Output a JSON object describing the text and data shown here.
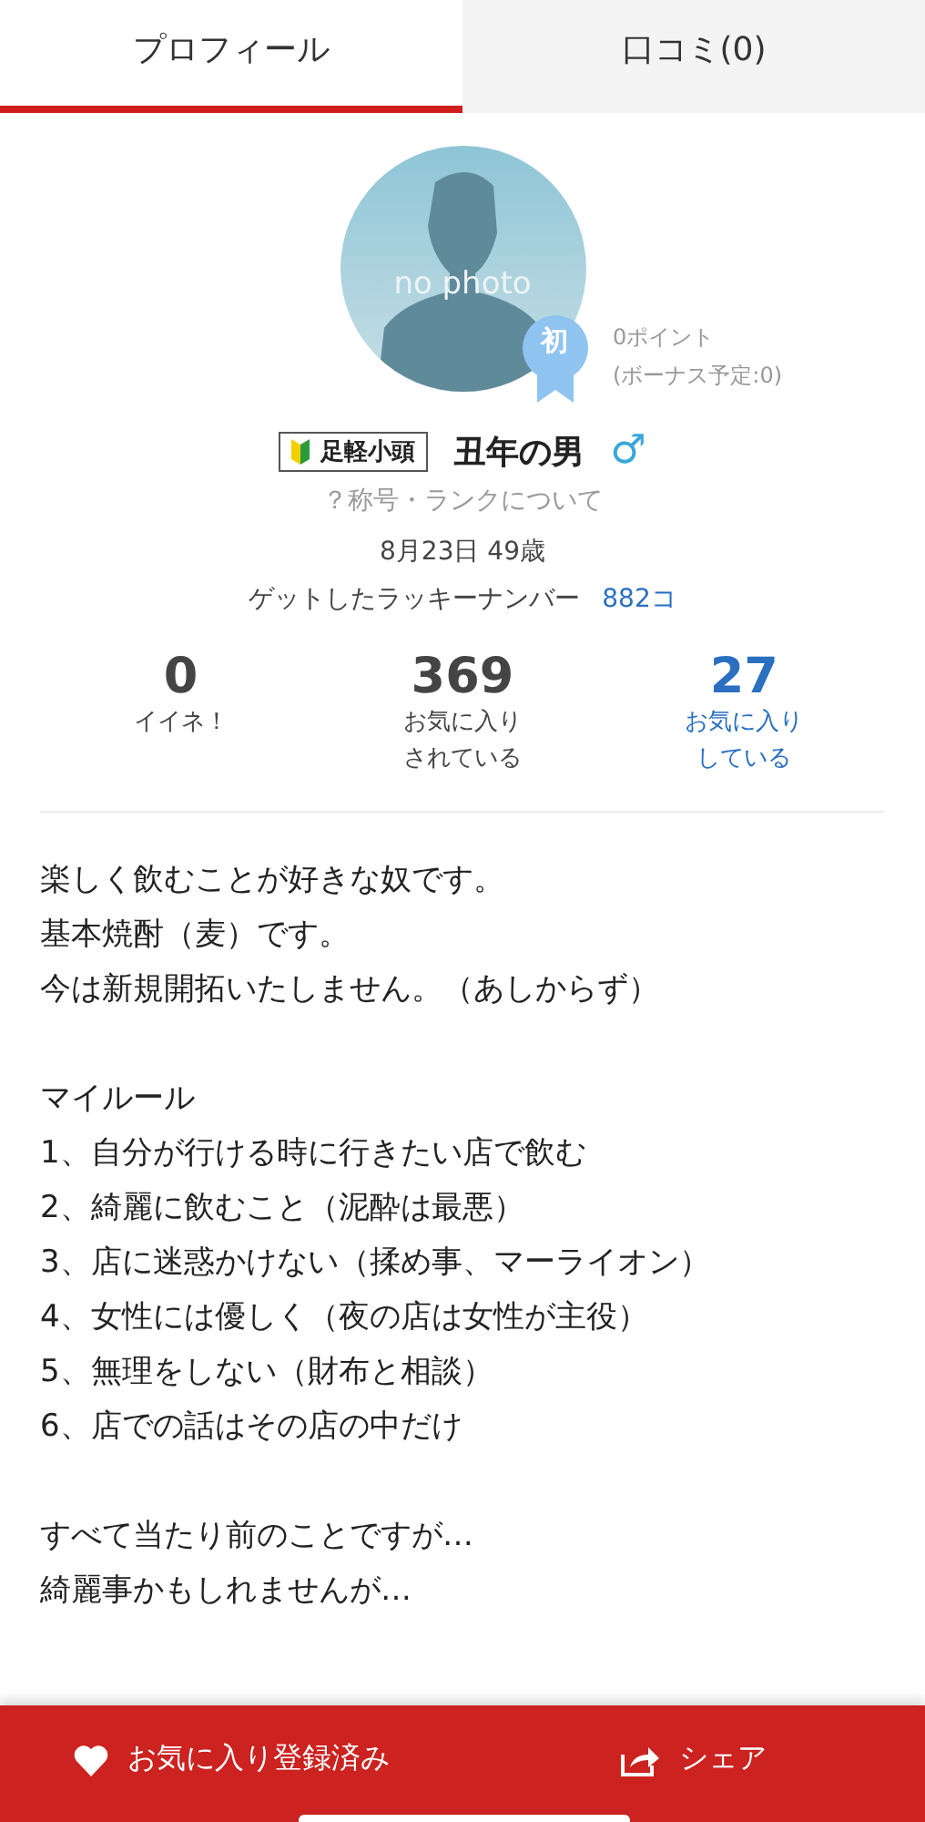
{
  "tabs": [
    {
      "label": "プロフィール",
      "selected": true
    },
    {
      "label": "口コミ(0)",
      "selected": false
    }
  ],
  "profile": {
    "avatar_text": "no photo",
    "rank_badge": "初",
    "points": "0ポイント",
    "bonus": "(ボーナス予定:0)",
    "title_badge": "足軽小頭",
    "name": "丑年の男",
    "gender_symbol": "♂",
    "rank_link": "？称号・ランクについて",
    "birthday": "8月23日 49歳",
    "lucky_label": "ゲットしたラッキーナンバー",
    "lucky_value": "882コ"
  },
  "stats": [
    {
      "value": "0",
      "label": [
        "イイネ！"
      ],
      "link": false
    },
    {
      "value": "369",
      "label": [
        "お気に入り",
        "されている"
      ],
      "link": false
    },
    {
      "value": "27",
      "label": [
        "お気に入り",
        "している"
      ],
      "link": true
    }
  ],
  "bio": [
    [
      "楽しく飲むことが好きな奴です。",
      "基本焼酎（麦）です。",
      "今は新規開拓いたしません。（あしからず）"
    ],
    [
      "マイルール",
      "1、自分が行ける時に行きたい店で飲む",
      "2、綺麗に飲むこと（泥酔は最悪）",
      "3、店に迷惑かけない（揉め事、マーライオン）",
      "4、女性には優しく（夜の店は女性が主役）",
      "5、無理をしない（財布と相談）",
      "6、店での話はその店の中だけ"
    ],
    [
      "すべて当たり前のことですが…",
      "綺麗事かもしれませんが…"
    ]
  ],
  "bottom_bar": {
    "favorite": "お気に入り登録済み",
    "share": "シェア"
  }
}
